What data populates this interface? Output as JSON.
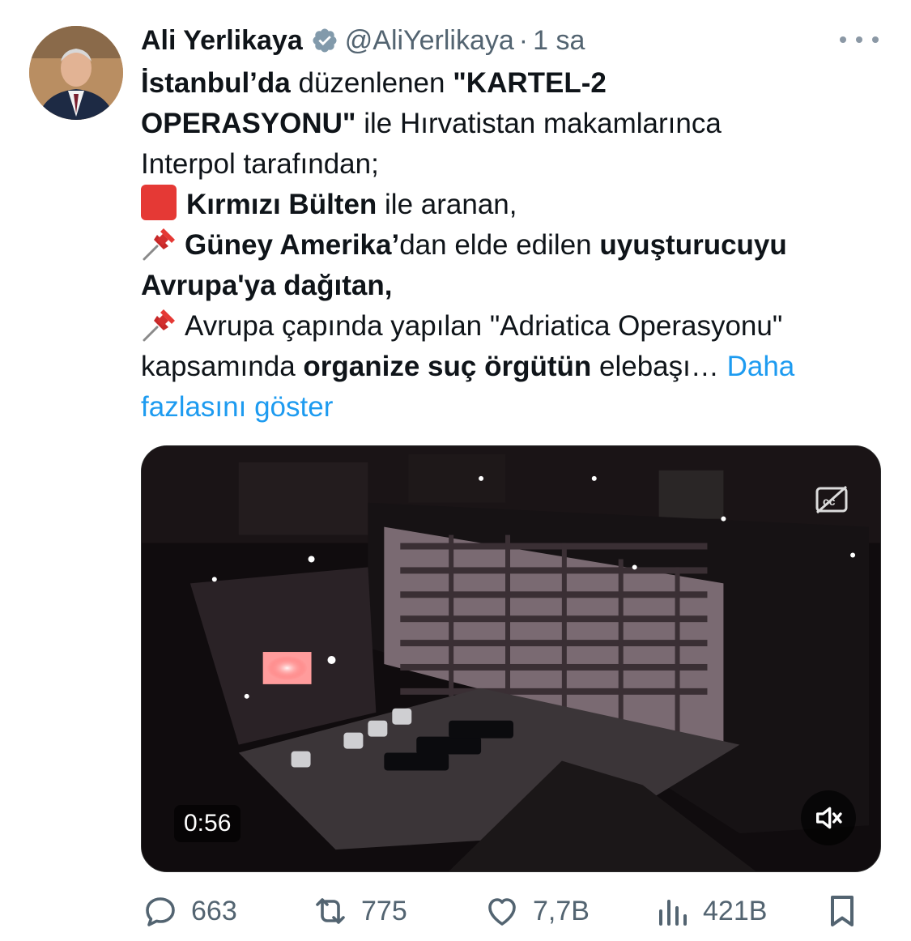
{
  "author": {
    "name": "Ali Yerlikaya",
    "handle": "@AliYerlikaya",
    "separator": "·",
    "time": "1 sa"
  },
  "tweet": {
    "l1_a": "İstanbul’da",
    "l1_b": " düzenlenen ",
    "l1_c": "\"KARTEL-2",
    "l2_a": "OPERASYONU\"",
    "l2_b": " ile Hırvatistan makamlarınca",
    "l3": "Interpol tarafından;",
    "l4_a": "Kırmızı Bülten",
    "l4_b": " ile aranan,",
    "l5_a": "Güney Amerika’",
    "l5_b": "dan elde edilen ",
    "l5_c": "uyuşturucuyu",
    "l6": "Avrupa'ya dağıtan,",
    "l7": "Avrupa çapında yapılan \"Adriatica Operasyonu\"",
    "l8_a": "kapsamında ",
    "l8_b": "organize suç örgütün",
    "l8_c": " elebaşı… ",
    "show_more_1": "Daha",
    "show_more_2": "fazlasını göster"
  },
  "media": {
    "duration": "0:56"
  },
  "actions": {
    "replies": "663",
    "retweets": "775",
    "likes": "7,7B",
    "views": "421B"
  },
  "colors": {
    "accent": "#1d9bf0",
    "muted": "#536471",
    "verified": "#829aab"
  }
}
